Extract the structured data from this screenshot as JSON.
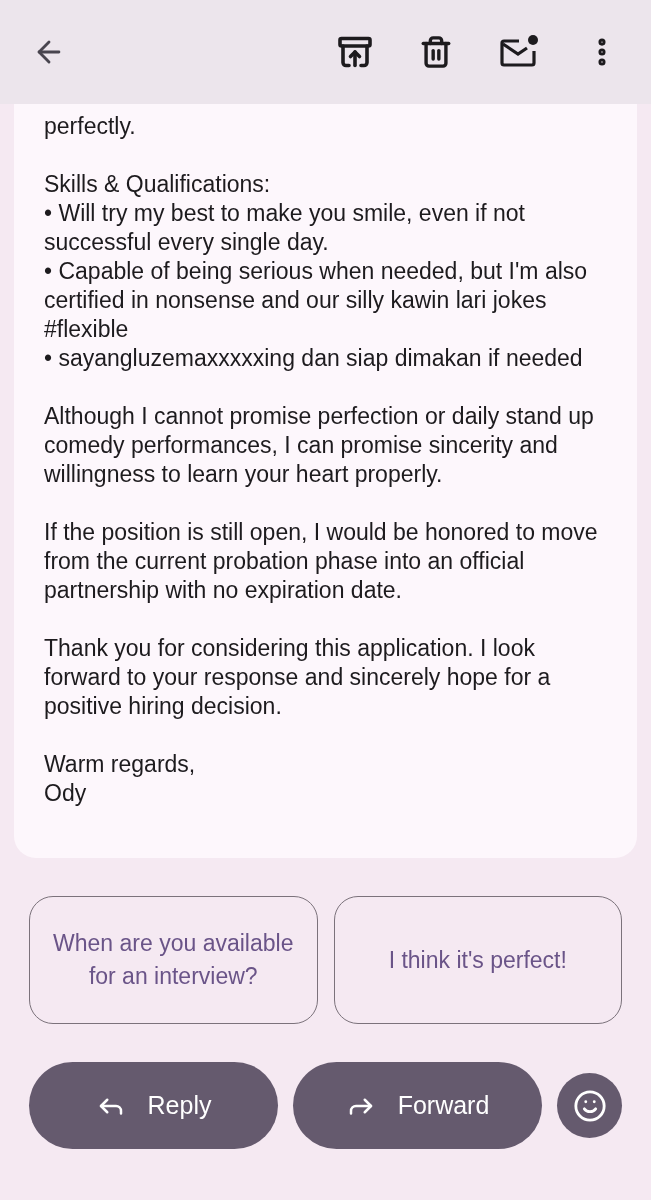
{
  "message": {
    "blocks": [
      [
        "perfectly."
      ],
      [
        "Skills & Qualifications:",
        "• Will try my best to make you smile, even if not successful every single day.",
        "• Capable of being serious when needed, but I'm also certified in nonsense and our silly kawin lari jokes #flexible",
        "• sayangluzemaxxxxxing dan siap dimakan if needed"
      ],
      [
        "Although I cannot promise perfection or daily stand up comedy performances, I can promise sincerity and willingness to learn your heart properly."
      ],
      [
        "If the position is still open, I would be honored to move from the current probation phase into an official partnership with no expiration date."
      ],
      [
        "Thank you for considering this application. I look forward to your response and sincerely hope for a positive hiring decision."
      ],
      [
        "Warm regards,",
        "Ody"
      ]
    ]
  },
  "smart_replies": [
    "When are you available for an interview?",
    "I think it's perfect!"
  ],
  "actions": [
    {
      "kind": "reply",
      "label": "Reply"
    },
    {
      "kind": "forward",
      "label": "Forward"
    }
  ]
}
